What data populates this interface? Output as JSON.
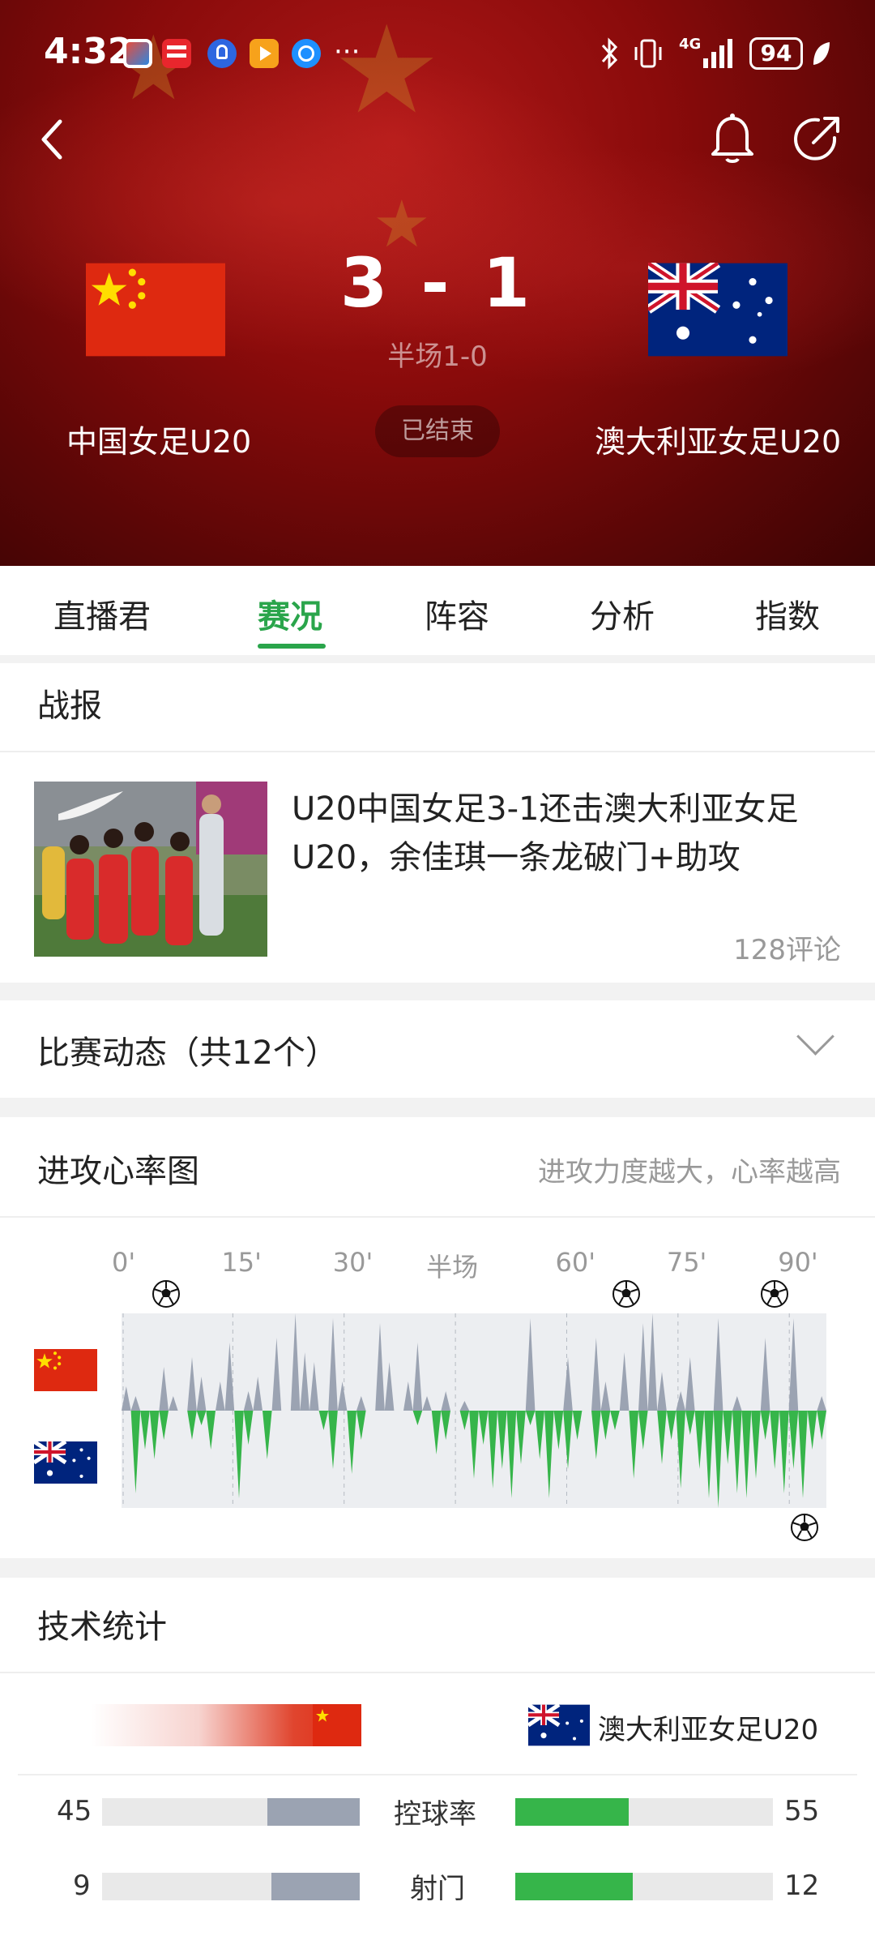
{
  "status_bar": {
    "time": "4:32",
    "app_icons": [
      "news-app-icon",
      "toutiao-app-icon",
      "bulb-app-icon",
      "video-app-icon",
      "browser-app-icon"
    ],
    "more": "···",
    "network": "4G",
    "battery": "94"
  },
  "match": {
    "score": "3 - 1",
    "half_time": "半场1-0",
    "status": "已结束",
    "home_team": "中国女足U20",
    "away_team": "澳大利亚女足U20",
    "home_flag": "china-flag",
    "away_flag": "australia-flag"
  },
  "tabs": [
    {
      "label": "直播君",
      "active": false
    },
    {
      "label": "赛况",
      "active": true
    },
    {
      "label": "阵容",
      "active": false
    },
    {
      "label": "分析",
      "active": false
    },
    {
      "label": "指数",
      "active": false
    }
  ],
  "report": {
    "section_title": "战报",
    "headline": "U20中国女足3-1还击澳大利亚女足U20，余佳琪一条龙破门+助攻",
    "comments": "128评论"
  },
  "events": {
    "title": "比赛动态（共12个）"
  },
  "heart_chart": {
    "title": "进攻心率图",
    "subtitle": "进攻力度越大，心率越高",
    "minute_labels": [
      "0'",
      "15'",
      "30'",
      "半场",
      "60'",
      "75'",
      "90'"
    ],
    "home_goal_minutes": [
      6,
      68,
      88
    ],
    "away_goal_minutes": [
      92
    ],
    "colors": {
      "home": "#9ba3b2",
      "away": "#36b54a"
    },
    "home_values": [
      0.25,
      0.15,
      0,
      0,
      0.45,
      0.15,
      0,
      0.55,
      0.35,
      0,
      0.3,
      0.7,
      0,
      0.2,
      0.35,
      0,
      0.75,
      0,
      1,
      0.6,
      0.5,
      0,
      0.95,
      0.3,
      0,
      0.15,
      0,
      0.9,
      0.5,
      0,
      0.3,
      0.7,
      0.15,
      0,
      0.2,
      0,
      0.1,
      0,
      0,
      0,
      0,
      0,
      0,
      0.95,
      0,
      0,
      0,
      0.55,
      0,
      0,
      0.75,
      0.3,
      0,
      0.6,
      0,
      0.9,
      1,
      0.4,
      0,
      0.2,
      0.55,
      0,
      0,
      0.95,
      0,
      0.15,
      0,
      0,
      0.75,
      0,
      0,
      0.95,
      0,
      0,
      0.15
    ],
    "away_values": [
      0,
      0.85,
      0.4,
      0.5,
      0.3,
      0,
      0,
      0.3,
      0.15,
      0.4,
      0,
      0,
      0.9,
      0.35,
      0,
      0.5,
      0,
      0,
      0,
      0,
      0,
      0.2,
      0.6,
      0,
      0.65,
      0.3,
      0,
      0,
      0,
      0,
      0,
      0.15,
      0,
      0.45,
      0.3,
      0,
      0.2,
      0.7,
      0.35,
      0.8,
      0.6,
      0.9,
      0.55,
      0.15,
      0.5,
      0.9,
      0.4,
      0.6,
      0.3,
      0,
      0.5,
      0.3,
      0.2,
      0,
      0.7,
      0.4,
      0,
      0.55,
      0.3,
      0.8,
      0.25,
      0.6,
      0.9,
      1,
      0.55,
      0.85,
      0.9,
      0.7,
      0.3,
      0.6,
      0.85,
      0.6,
      0.9,
      0.4,
      0.3
    ]
  },
  "tech_stats": {
    "title": "技术统计",
    "away_team": "澳大利亚女足U20",
    "rows": [
      {
        "label": "控球率",
        "home": "45",
        "away": "55",
        "home_frac": 0.45,
        "away_frac": 0.55
      },
      {
        "label": "射门",
        "home": "9",
        "away": "12",
        "home_frac": 0.43,
        "away_frac": 0.57
      }
    ]
  }
}
